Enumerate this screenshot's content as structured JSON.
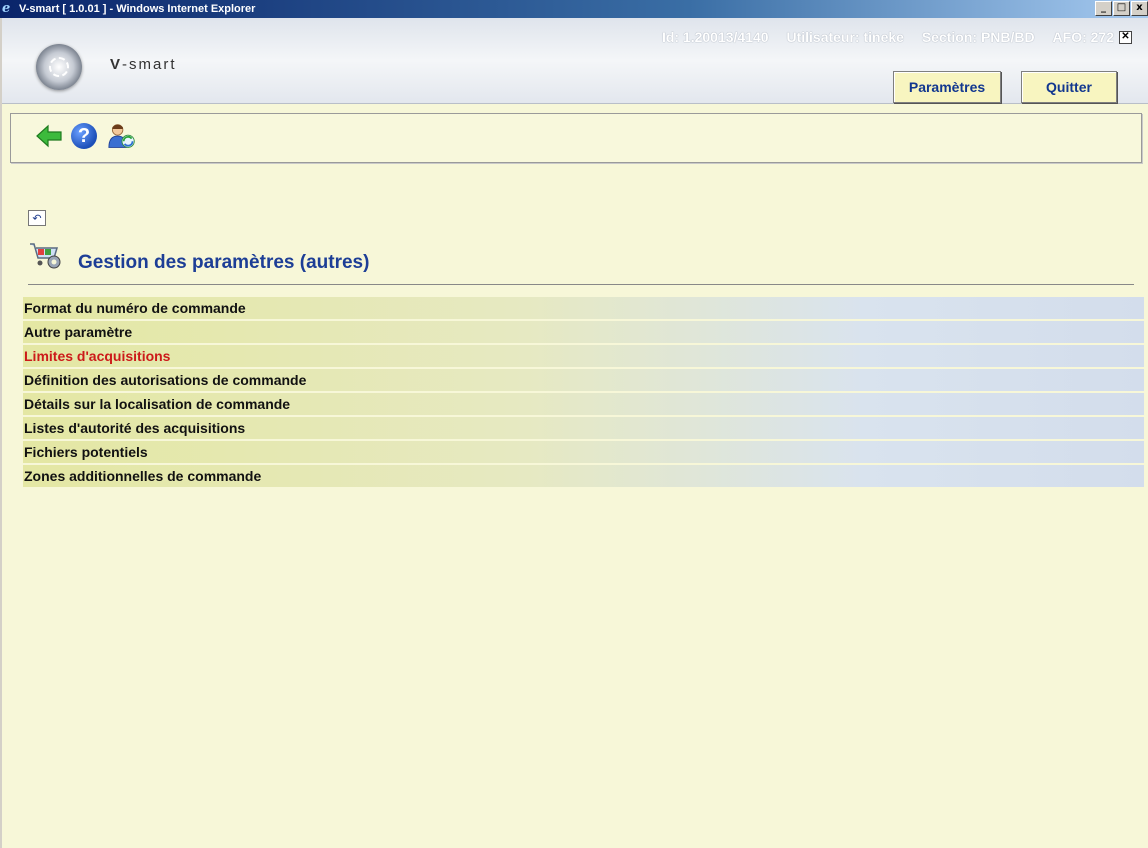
{
  "window": {
    "title": "V-smart [ 1.0.01 ] - Windows Internet Explorer",
    "controls": [
      "_",
      "□",
      "x"
    ]
  },
  "header": {
    "brand_v": "V",
    "brand_rest": "-smart",
    "id_label": "Id: 1.20013/4140",
    "user_label": "Utilisateur: tineke",
    "section_label": "Section: PNB/BD",
    "afo_label": "AFO: 272",
    "close_glyph": "✕",
    "params_button": "Paramètres",
    "quit_button": "Quitter"
  },
  "toolbar": {
    "icons": [
      "back-arrow-icon",
      "help-icon",
      "user-refresh-icon"
    ]
  },
  "page": {
    "title": "Gestion des paramètres (autres)",
    "small_back_glyph": "↶"
  },
  "menu": {
    "items": [
      {
        "label": "Format du numéro de commande",
        "active": false
      },
      {
        "label": "Autre paramètre",
        "active": false
      },
      {
        "label": "Limites d'acquisitions",
        "active": true
      },
      {
        "label": "Définition des autorisations de commande",
        "active": false
      },
      {
        "label": "Détails sur la localisation de commande",
        "active": false
      },
      {
        "label": "Listes d'autorité des acquisitions",
        "active": false
      },
      {
        "label": "Fichiers potentiels",
        "active": false
      },
      {
        "label": "Zones additionnelles de commande",
        "active": false
      }
    ]
  },
  "colors": {
    "active_item": "#cc1a1a",
    "title": "#1d3e96",
    "button_text": "#12378f"
  }
}
